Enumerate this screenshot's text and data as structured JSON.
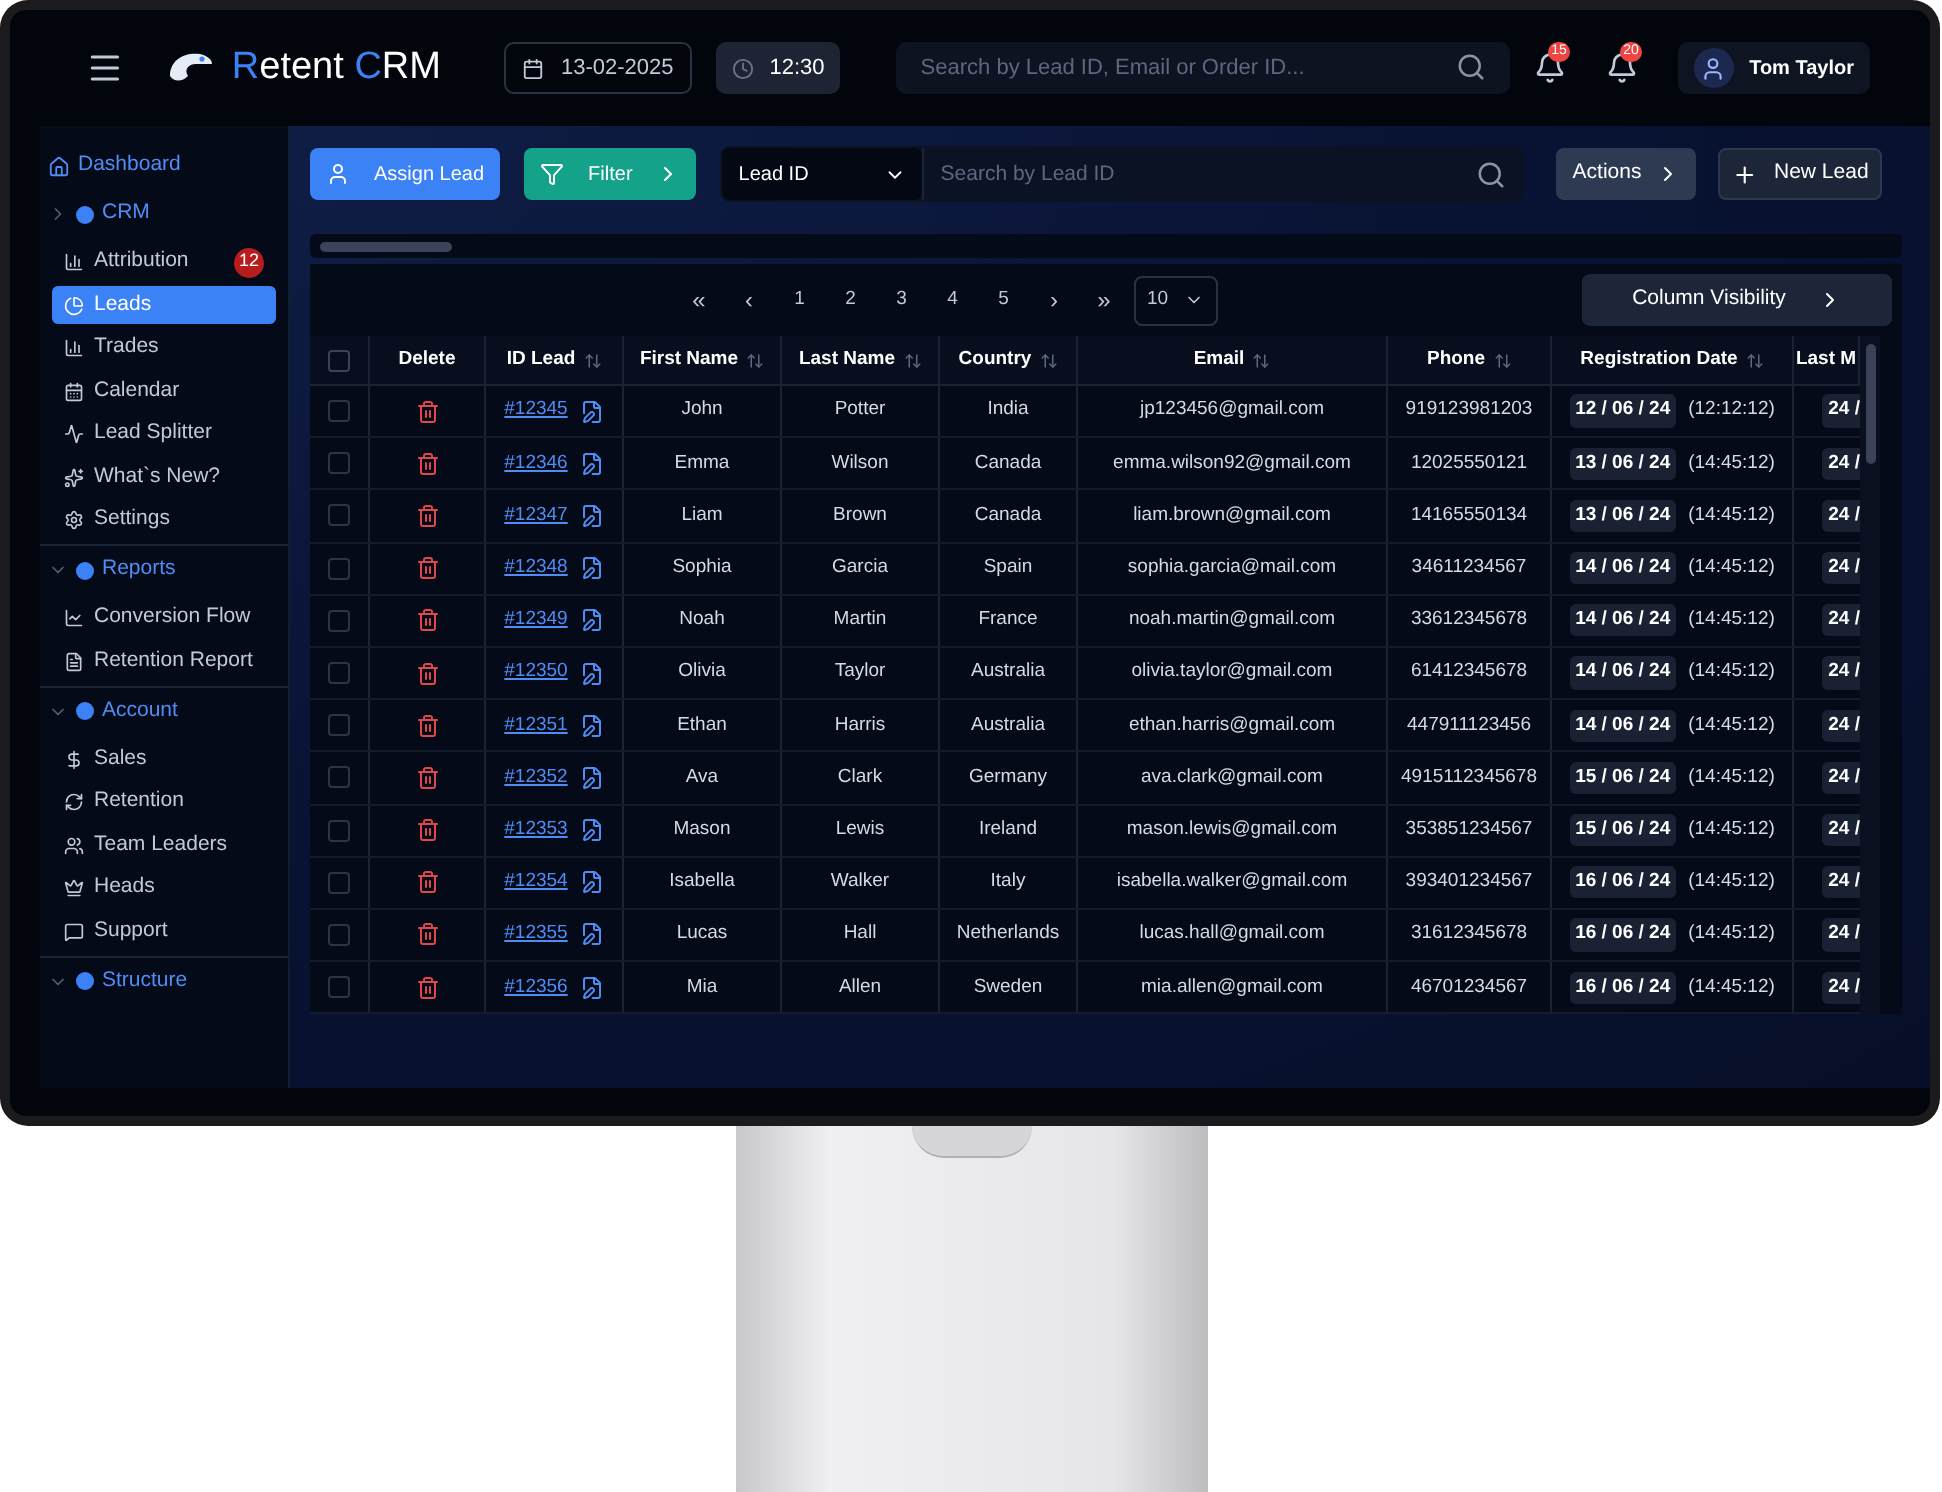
{
  "topbar": {
    "logo": [
      {
        "text": "R",
        "accent": true
      },
      {
        "text": "etent ",
        "accent": false
      },
      {
        "text": "C",
        "accent": true
      },
      {
        "text": "RM",
        "accent": false
      }
    ],
    "date": "13-02-2025",
    "time": "12:30",
    "search": {
      "placeholder": "Search by Lead ID, Email or Order ID..."
    },
    "notifications": [
      {
        "count": "15"
      },
      {
        "count": "20"
      }
    ],
    "user": "Tom Taylor"
  },
  "sidebar": {
    "dashboard": "Dashboard",
    "groups": [
      {
        "label": "CRM",
        "expanded": false,
        "items": [
          {
            "label": "Attribution",
            "selected": false,
            "badge": "12"
          },
          {
            "label": "Leads",
            "selected": true
          },
          {
            "label": "Trades",
            "selected": false
          },
          {
            "label": "Calendar",
            "selected": false
          },
          {
            "label": "Lead Splitter",
            "selected": false
          },
          {
            "label": "What`s New?",
            "selected": false
          },
          {
            "label": "Settings",
            "selected": false
          }
        ]
      },
      {
        "label": "Reports",
        "expanded": true,
        "items": [
          {
            "label": "Conversion Flow",
            "selected": false
          },
          {
            "label": "Retention Report",
            "selected": false
          }
        ]
      },
      {
        "label": "Account",
        "expanded": true,
        "items": [
          {
            "label": "Sales",
            "selected": false
          },
          {
            "label": "Retention",
            "selected": false
          },
          {
            "label": "Team Leaders",
            "selected": false
          },
          {
            "label": "Heads",
            "selected": false
          },
          {
            "label": "Support",
            "selected": false
          }
        ]
      },
      {
        "label": "Structure",
        "expanded": true
      }
    ]
  },
  "toolbar": {
    "assign": "Assign Lead",
    "filter": "Filter",
    "field_select": "Lead ID",
    "search": {
      "placeholder": "Search by Lead ID"
    },
    "actions": "Actions",
    "new_lead": "New Lead"
  },
  "pagination": {
    "first": "«",
    "prev": "‹",
    "pages": [
      "1",
      "2",
      "3",
      "4",
      "5"
    ],
    "next": "›",
    "last": "»",
    "page_size": "10"
  },
  "column_visibility": "Column Visibility",
  "table": {
    "all_checked": false,
    "columns": [
      {
        "label": "Delete",
        "sortable": false
      },
      {
        "label": "ID Lead",
        "sortable": true
      },
      {
        "label": "First Name",
        "sortable": true
      },
      {
        "label": "Last Name",
        "sortable": true
      },
      {
        "label": "Country",
        "sortable": true
      },
      {
        "label": "Email",
        "sortable": true
      },
      {
        "label": "Phone",
        "sortable": true
      },
      {
        "label": "Registration Date",
        "sortable": true
      },
      {
        "label": "Last M",
        "sortable": false
      }
    ],
    "rows": [
      {
        "checked": false,
        "id": "#12345",
        "first": "John",
        "last": "Potter",
        "country": "India",
        "email": "jp123456@gmail.com",
        "phone": "919123981203",
        "reg_date": "12 / 06 / 24",
        "reg_time": "(12:12:12)",
        "column_10": "24 /"
      },
      {
        "checked": false,
        "id": "#12346",
        "first": "Emma",
        "last": "Wilson",
        "country": "Canada",
        "email": "emma.wilson92@gmail.com",
        "phone": "12025550121",
        "reg_date": "13 / 06 / 24",
        "reg_time": "(14:45:12)",
        "column_10": "24 /"
      },
      {
        "checked": false,
        "id": "#12347",
        "first": "Liam",
        "last": "Brown",
        "country": "Canada",
        "email": "liam.brown@gmail.com",
        "phone": "14165550134",
        "reg_date": "13 / 06 / 24",
        "reg_time": "(14:45:12)",
        "column_10": "24 /"
      },
      {
        "checked": false,
        "id": "#12348",
        "first": "Sophia",
        "last": "Garcia",
        "country": "Spain",
        "email": "sophia.garcia@mail.com",
        "phone": "34611234567",
        "reg_date": "14 / 06 / 24",
        "reg_time": "(14:45:12)",
        "column_10": "24 /"
      },
      {
        "checked": false,
        "id": "#12349",
        "first": "Noah",
        "last": "Martin",
        "country": "France",
        "email": "noah.martin@gmail.com",
        "phone": "33612345678",
        "reg_date": "14 / 06 / 24",
        "reg_time": "(14:45:12)",
        "column_10": "24 /"
      },
      {
        "checked": false,
        "id": "#12350",
        "first": "Olivia",
        "last": "Taylor",
        "country": "Australia",
        "email": "olivia.taylor@gmail.com",
        "phone": "61412345678",
        "reg_date": "14 / 06 / 24",
        "reg_time": "(14:45:12)",
        "column_10": "24 /"
      },
      {
        "checked": false,
        "id": "#12351",
        "first": "Ethan",
        "last": "Harris",
        "country": "Australia",
        "email": "ethan.harris@gmail.com",
        "phone": "447911123456",
        "reg_date": "14 / 06 / 24",
        "reg_time": "(14:45:12)",
        "column_10": "24 /"
      },
      {
        "checked": false,
        "id": "#12352",
        "first": "Ava",
        "last": "Clark",
        "country": "Germany",
        "email": "ava.clark@gmail.com",
        "phone": "4915112345678",
        "reg_date": "15 / 06 / 24",
        "reg_time": "(14:45:12)",
        "column_10": "24 /"
      },
      {
        "checked": false,
        "id": "#12353",
        "first": "Mason",
        "last": "Lewis",
        "country": "Ireland",
        "email": "mason.lewis@gmail.com",
        "phone": "353851234567",
        "reg_date": "15 / 06 / 24",
        "reg_time": "(14:45:12)",
        "column_10": "24 /"
      },
      {
        "checked": false,
        "id": "#12354",
        "first": "Isabella",
        "last": "Walker",
        "country": "Italy",
        "email": "isabella.walker@gmail.com",
        "phone": "393401234567",
        "reg_date": "16 / 06 / 24",
        "reg_time": "(14:45:12)",
        "column_10": "24 /"
      },
      {
        "checked": false,
        "id": "#12355",
        "first": "Lucas",
        "last": "Hall",
        "country": "Netherlands",
        "email": "lucas.hall@gmail.com",
        "phone": "31612345678",
        "reg_date": "16 / 06 / 24",
        "reg_time": "(14:45:12)",
        "column_10": "24 /"
      },
      {
        "checked": false,
        "id": "#12356",
        "first": "Mia",
        "last": "Allen",
        "country": "Sweden",
        "email": "mia.allen@gmail.com",
        "phone": "46701234567",
        "reg_date": "16 / 06 / 24",
        "reg_time": "(14:45:12)",
        "column_10": "24 /"
      }
    ]
  }
}
